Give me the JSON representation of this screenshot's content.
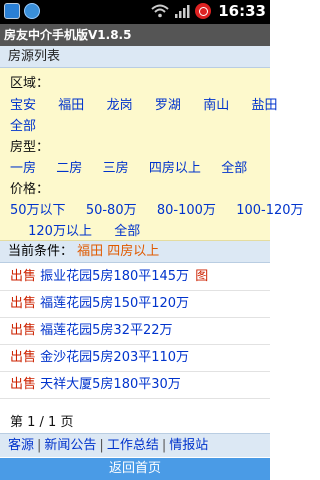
{
  "status_bar": {
    "time": "16:33",
    "icons": [
      "app-icon",
      "browser-icon",
      "wifi-icon",
      "signal-icon",
      "alarm-icon"
    ]
  },
  "app_title": "房友中介手机版V1.8.5",
  "section_title": "房源列表",
  "filters": {
    "region_label": "区域：",
    "regions": [
      "宝安",
      "福田",
      "龙岗",
      "罗湖",
      "南山",
      "盐田",
      "全部"
    ],
    "type_label": "房型：",
    "types": [
      "一房",
      "二房",
      "三房",
      "四房以上",
      "全部"
    ],
    "price_label": "价格：",
    "prices": [
      "50万以下",
      "50-80万",
      "80-100万",
      "100-120万",
      "120万以上",
      "全部"
    ]
  },
  "current_conditions": {
    "label": "当前条件：",
    "value": "福田 四房以上"
  },
  "listings": [
    {
      "tag": "出售",
      "title": "振业花园5房180平145万",
      "pic": "图"
    },
    {
      "tag": "出售",
      "title": "福莲花园5房150平120万",
      "pic": ""
    },
    {
      "tag": "出售",
      "title": "福莲花园5房32平22万",
      "pic": ""
    },
    {
      "tag": "出售",
      "title": "金沙花园5房203平110万",
      "pic": ""
    },
    {
      "tag": "出售",
      "title": "天祥大厦5房180平30万",
      "pic": ""
    }
  ],
  "pager": "第 1 / 1 页",
  "footer_links": [
    "客源",
    "新闻公告",
    "工作总结",
    "情报站"
  ],
  "home_button": "返回首页",
  "colors": {
    "link": "#0033cc",
    "sale_tag": "#cc2200",
    "condition": "#e05a00",
    "filter_bg": "#fdf9cc",
    "header_bg": "#dce8f4",
    "home_btn": "#4a9be6"
  }
}
